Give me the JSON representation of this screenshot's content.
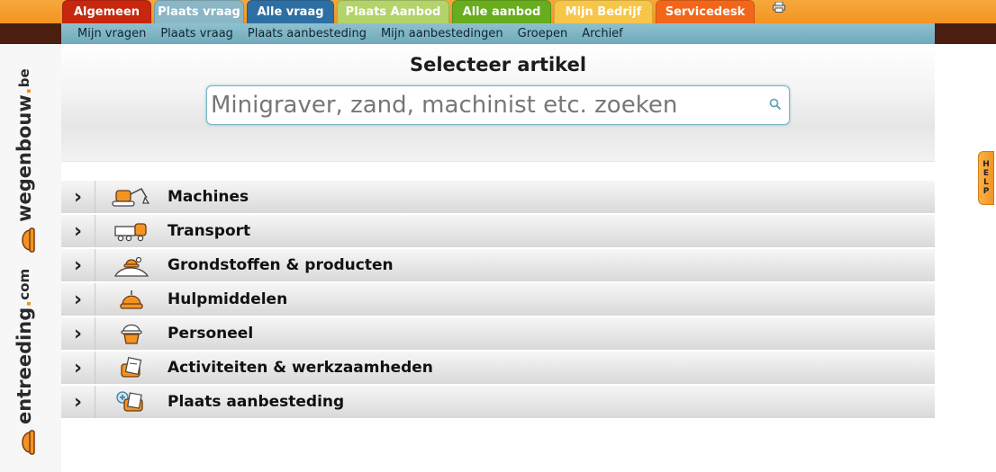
{
  "tabs": [
    {
      "label": "Algemeen",
      "color": "#c8270f",
      "width": 99
    },
    {
      "label": "Plaats vraag",
      "color": "#8ab6c5",
      "width": 100
    },
    {
      "label": "Alle vraag",
      "color": "#2d6fa3",
      "width": 97
    },
    {
      "label": "Plaats Aanbod",
      "color": "#b3d36b",
      "width": 125
    },
    {
      "label": "Alle aanbod",
      "color": "#68ad1d",
      "width": 110
    },
    {
      "label": "Mijn Bedrijf",
      "color": "#f7c548",
      "width": 110
    },
    {
      "label": "Servicedesk",
      "color": "#f3661a",
      "width": 110
    }
  ],
  "subnav": [
    "Mijn vragen",
    "Plaats vraag",
    "Plaats aanbesteding",
    "Mijn aanbestedingen",
    "Groepen",
    "Archief"
  ],
  "logo": {
    "brand1": "wegenbouw",
    "tld1": "be",
    "brand2": "entreeding",
    "tld2": "com"
  },
  "page_title": "Selecteer artikel",
  "search": {
    "placeholder": "Minigraver, zand, machinist etc. zoeken",
    "value": ""
  },
  "categories": [
    {
      "label": "Machines",
      "icon": "excavator-icon"
    },
    {
      "label": "Transport",
      "icon": "truck-icon"
    },
    {
      "label": "Grondstoffen & producten",
      "icon": "sand-pile-icon"
    },
    {
      "label": "Hulpmiddelen",
      "icon": "tool-icon"
    },
    {
      "label": "Personeel",
      "icon": "worker-icon"
    },
    {
      "label": "Activiteiten & werkzaamheden",
      "icon": "activity-icon"
    },
    {
      "label": "Plaats aanbesteding",
      "icon": "tender-icon"
    }
  ],
  "help_label": "HELP",
  "colors": {
    "accent": "#f39422",
    "brown": "#4a1f12",
    "subnav": "#7fb5c6"
  }
}
